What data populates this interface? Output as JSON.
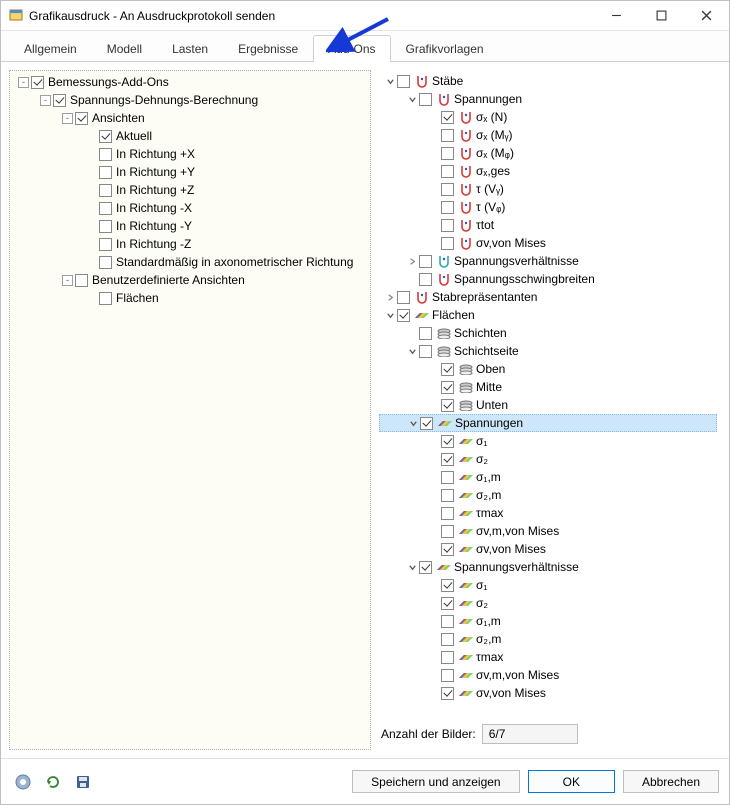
{
  "window": {
    "title": "Grafikausdruck - An Ausdruckprotokoll senden"
  },
  "tabs": [
    {
      "id": "tab-allgemein",
      "label": "Allgemein",
      "active": false
    },
    {
      "id": "tab-modell",
      "label": "Modell",
      "active": false
    },
    {
      "id": "tab-lasten",
      "label": "Lasten",
      "active": false
    },
    {
      "id": "tab-ergebnisse",
      "label": "Ergebnisse",
      "active": false
    },
    {
      "id": "tab-addons",
      "label": "Add-Ons",
      "active": true
    },
    {
      "id": "tab-grafikvorlagen",
      "label": "Grafikvorlagen",
      "active": false
    }
  ],
  "left_tree": [
    {
      "indent": 0,
      "legacy": "-",
      "checked": true,
      "label": "Bemessungs-Add-Ons"
    },
    {
      "indent": 1,
      "legacy": "-",
      "checked": true,
      "label": "Spannungs-Dehnungs-Berechnung"
    },
    {
      "indent": 2,
      "legacy": "-",
      "checked": true,
      "label": "Ansichten"
    },
    {
      "indent": 3,
      "legacy": "",
      "checked": true,
      "label": "Aktuell"
    },
    {
      "indent": 3,
      "legacy": "",
      "checked": false,
      "label": "In Richtung +X"
    },
    {
      "indent": 3,
      "legacy": "",
      "checked": false,
      "label": "In Richtung +Y"
    },
    {
      "indent": 3,
      "legacy": "",
      "checked": false,
      "label": "In Richtung +Z"
    },
    {
      "indent": 3,
      "legacy": "",
      "checked": false,
      "label": "In Richtung -X"
    },
    {
      "indent": 3,
      "legacy": "",
      "checked": false,
      "label": "In Richtung -Y"
    },
    {
      "indent": 3,
      "legacy": "",
      "checked": false,
      "label": "In Richtung -Z"
    },
    {
      "indent": 3,
      "legacy": "",
      "checked": false,
      "label": "Standardmäßig in axonometrischer Richtung"
    },
    {
      "indent": 2,
      "legacy": "-",
      "checked": false,
      "label": "Benutzerdefinierte Ansichten"
    },
    {
      "indent": 3,
      "legacy": "",
      "checked": false,
      "label": "Flächen"
    }
  ],
  "right_tree": [
    {
      "indent": 0,
      "exp": "down",
      "checked": false,
      "icon": "barsec",
      "label": "Stäbe"
    },
    {
      "indent": 1,
      "exp": "down",
      "checked": false,
      "icon": "barsec",
      "label": "Spannungen"
    },
    {
      "indent": 2,
      "exp": "",
      "checked": true,
      "icon": "barsec",
      "label": "σₓ (N)"
    },
    {
      "indent": 2,
      "exp": "",
      "checked": false,
      "icon": "barsec",
      "label": "σₓ (Mᵧ)"
    },
    {
      "indent": 2,
      "exp": "",
      "checked": false,
      "icon": "barsec",
      "label": "σₓ (Mᵩ)"
    },
    {
      "indent": 2,
      "exp": "",
      "checked": false,
      "icon": "barsec",
      "label": "σₓ,ges"
    },
    {
      "indent": 2,
      "exp": "",
      "checked": false,
      "icon": "barsec",
      "label": "τ (Vᵧ)"
    },
    {
      "indent": 2,
      "exp": "",
      "checked": false,
      "icon": "barsec",
      "label": "τ (Vᵩ)"
    },
    {
      "indent": 2,
      "exp": "",
      "checked": false,
      "icon": "barsec",
      "label": "τtot"
    },
    {
      "indent": 2,
      "exp": "",
      "checked": false,
      "icon": "barsec",
      "label": "σv,von Mises"
    },
    {
      "indent": 1,
      "exp": "right",
      "checked": false,
      "icon": "ratio",
      "label": "Spannungsverhältnisse"
    },
    {
      "indent": 1,
      "exp": "",
      "checked": false,
      "icon": "barsec",
      "label": "Spannungsschwingbreiten"
    },
    {
      "indent": 0,
      "exp": "right",
      "checked": false,
      "icon": "barsec",
      "label": "Stabrepräsentanten"
    },
    {
      "indent": 0,
      "exp": "down",
      "checked": true,
      "icon": "surface",
      "label": "Flächen"
    },
    {
      "indent": 1,
      "exp": "",
      "checked": false,
      "icon": "layers",
      "label": "Schichten"
    },
    {
      "indent": 1,
      "exp": "down",
      "checked": false,
      "icon": "layers",
      "label": "Schichtseite"
    },
    {
      "indent": 2,
      "exp": "",
      "checked": true,
      "icon": "layers",
      "label": "Oben"
    },
    {
      "indent": 2,
      "exp": "",
      "checked": true,
      "icon": "layers",
      "label": "Mitte"
    },
    {
      "indent": 2,
      "exp": "",
      "checked": true,
      "icon": "layers",
      "label": "Unten"
    },
    {
      "indent": 1,
      "exp": "down",
      "checked": true,
      "icon": "surface",
      "label": "Spannungen",
      "selected": true
    },
    {
      "indent": 2,
      "exp": "",
      "checked": true,
      "icon": "surface",
      "label": "σ₁"
    },
    {
      "indent": 2,
      "exp": "",
      "checked": true,
      "icon": "surface",
      "label": "σ₂"
    },
    {
      "indent": 2,
      "exp": "",
      "checked": false,
      "icon": "surface",
      "label": "σ₁,m"
    },
    {
      "indent": 2,
      "exp": "",
      "checked": false,
      "icon": "surface",
      "label": "σ₂,m"
    },
    {
      "indent": 2,
      "exp": "",
      "checked": false,
      "icon": "surface",
      "label": "τmax"
    },
    {
      "indent": 2,
      "exp": "",
      "checked": false,
      "icon": "surface",
      "label": "σv,m,von Mises"
    },
    {
      "indent": 2,
      "exp": "",
      "checked": true,
      "icon": "surface",
      "label": "σv,von Mises"
    },
    {
      "indent": 1,
      "exp": "down",
      "checked": true,
      "icon": "surface",
      "label": "Spannungsverhältnisse"
    },
    {
      "indent": 2,
      "exp": "",
      "checked": true,
      "icon": "surface",
      "label": "σ₁"
    },
    {
      "indent": 2,
      "exp": "",
      "checked": true,
      "icon": "surface",
      "label": "σ₂"
    },
    {
      "indent": 2,
      "exp": "",
      "checked": false,
      "icon": "surface",
      "label": "σ₁,m"
    },
    {
      "indent": 2,
      "exp": "",
      "checked": false,
      "icon": "surface",
      "label": "σ₂,m"
    },
    {
      "indent": 2,
      "exp": "",
      "checked": false,
      "icon": "surface",
      "label": "τmax"
    },
    {
      "indent": 2,
      "exp": "",
      "checked": false,
      "icon": "surface",
      "label": "σv,m,von Mises"
    },
    {
      "indent": 2,
      "exp": "",
      "checked": true,
      "icon": "surface",
      "label": "σv,von Mises"
    }
  ],
  "count": {
    "label": "Anzahl der Bilder:",
    "value": "6/7"
  },
  "footer": {
    "save_show": "Speichern und anzeigen",
    "ok": "OK",
    "cancel": "Abbrechen"
  }
}
